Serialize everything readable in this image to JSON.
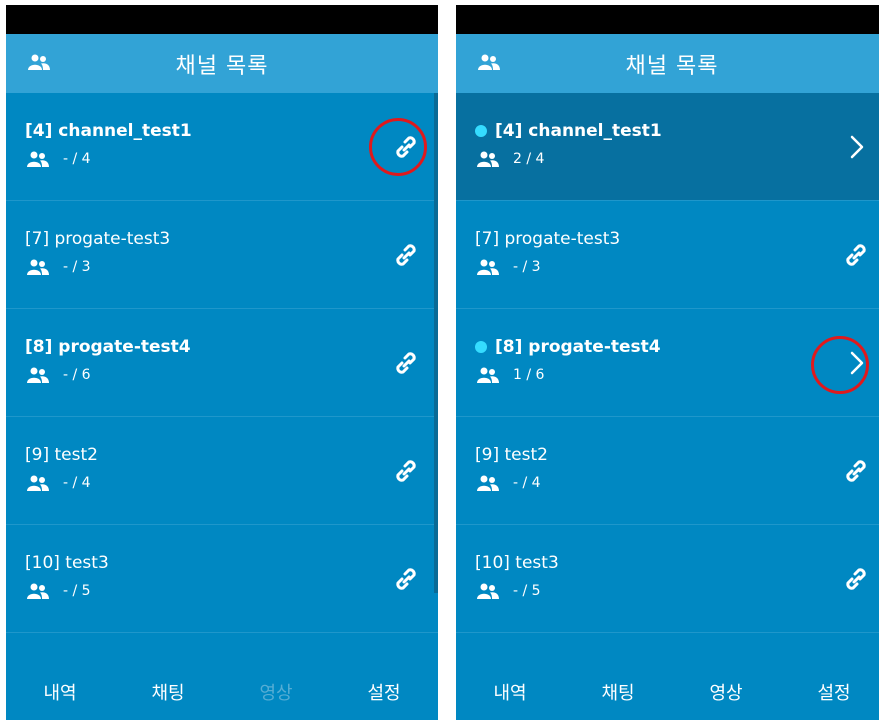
{
  "header": {
    "title": "채널 목록",
    "icon": "people-icon"
  },
  "left_screen": {
    "channels": [
      {
        "label": "[4] channel_test1",
        "count": "- / 4",
        "action_icon": "link-icon"
      },
      {
        "label": "[7] progate-test3",
        "count": "- / 3",
        "action_icon": "link-icon"
      },
      {
        "label": "[8] progate-test4",
        "count": "- / 6",
        "action_icon": "link-icon"
      },
      {
        "label": "[9] test2",
        "count": "- / 4",
        "action_icon": "link-icon"
      },
      {
        "label": "[10] test3",
        "count": "- / 5",
        "action_icon": "link-icon"
      }
    ],
    "nav": [
      "내역",
      "채팅",
      "영상",
      "설정"
    ]
  },
  "right_screen": {
    "channels": [
      {
        "label": "[4] channel_test1",
        "count": "2 / 4",
        "action_icon": "chevron-right-icon"
      },
      {
        "label": "[7] progate-test3",
        "count": "- / 3",
        "action_icon": "link-icon"
      },
      {
        "label": "[8] progate-test4",
        "count": "1 / 6",
        "action_icon": "chevron-right-icon"
      },
      {
        "label": "[9] test2",
        "count": "- / 4",
        "action_icon": "link-icon"
      },
      {
        "label": "[10] test3",
        "count": "- / 5",
        "action_icon": "link-icon"
      }
    ],
    "nav": [
      "내역",
      "채팅",
      "영상",
      "설정"
    ]
  },
  "colors": {
    "background": "#0088c2",
    "header": "#32a3d6",
    "active_row": "#0770a0",
    "indicator_dot": "#35dcff",
    "highlight_ring": "#e0191c"
  }
}
